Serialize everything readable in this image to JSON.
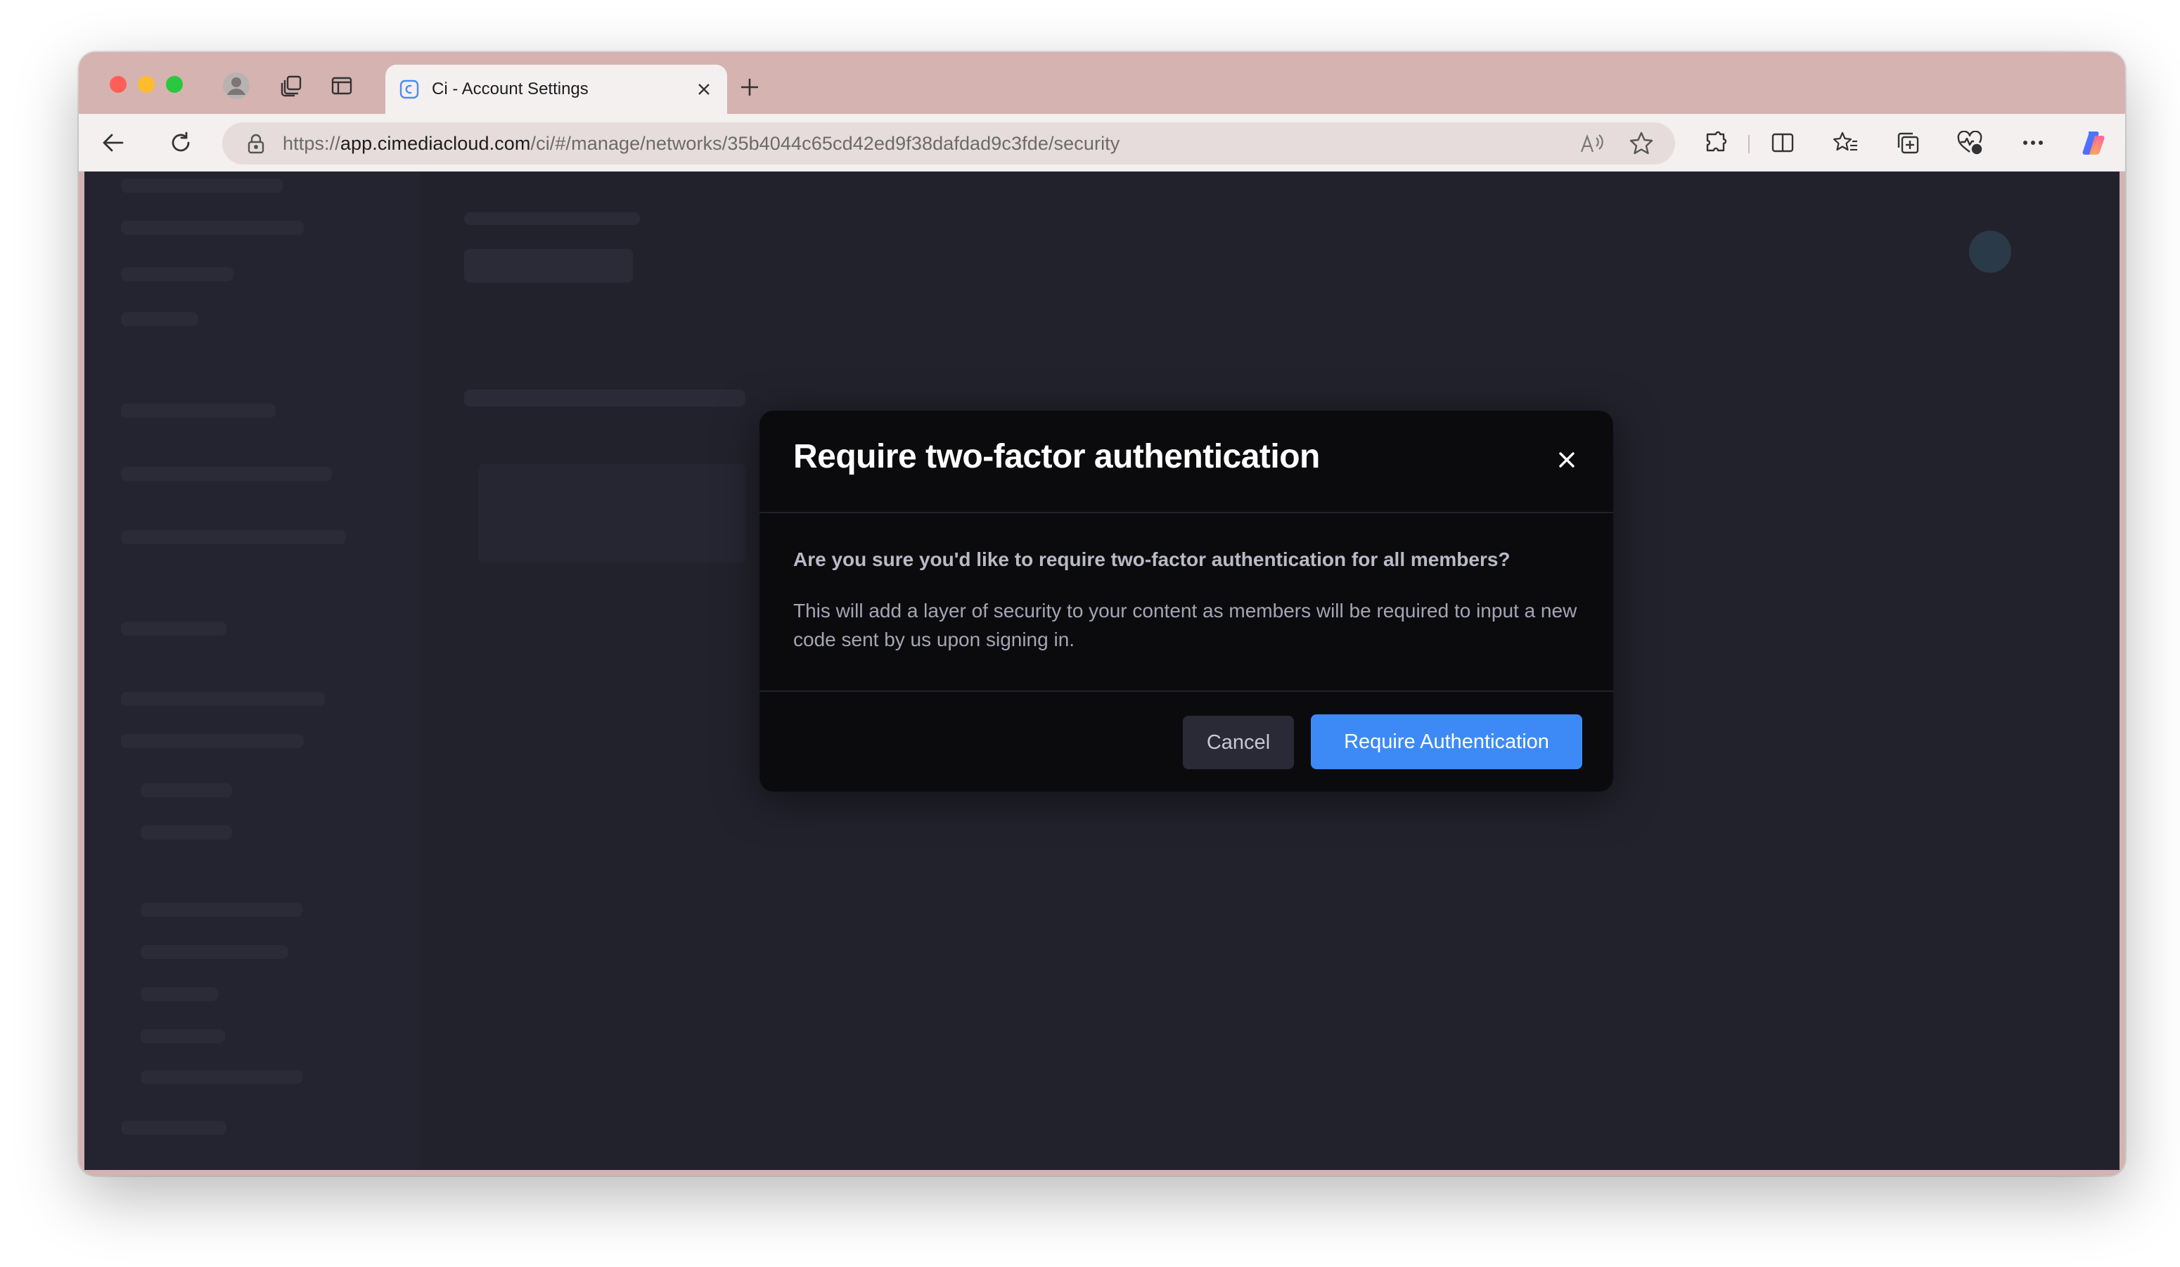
{
  "browser": {
    "tab": {
      "title": "Ci - Account Settings"
    },
    "url": {
      "scheme": "https://",
      "host": "app.cimediacloud.com",
      "path": "/ci/#/manage/networks/35b4044c65cd42ed9f38dafdad9c3fde/security"
    },
    "icons": {
      "profile": "profile-icon",
      "workspaces": "workspaces-icon",
      "sidebar": "vertical-tabs-icon",
      "back": "back-arrow-icon",
      "refresh": "refresh-icon",
      "lock": "lock-icon",
      "read_aloud": "read-aloud-icon",
      "favorite": "star-icon",
      "extensions": "extensions-icon",
      "split_screen": "split-screen-icon",
      "favorites": "favorites-icon",
      "collections": "collections-icon",
      "browser_essentials": "heart-pulse-icon",
      "more": "more-icon",
      "copilot": "copilot-icon"
    }
  },
  "modal": {
    "title": "Require two-factor authentication",
    "question": "Are you sure you'd like to require two-factor authentication for all members?",
    "description": "This will add a layer of security to your content as members will be required to input a new code sent by us upon signing in.",
    "cancel_label": "Cancel",
    "confirm_label": "Require Authentication"
  },
  "colors": {
    "titlebar": "#d5b3b0",
    "page_background": "#22222d",
    "modal_background": "#0b0b0e",
    "primary_button": "#3d8af7",
    "cancel_button": "#2a2a36"
  }
}
